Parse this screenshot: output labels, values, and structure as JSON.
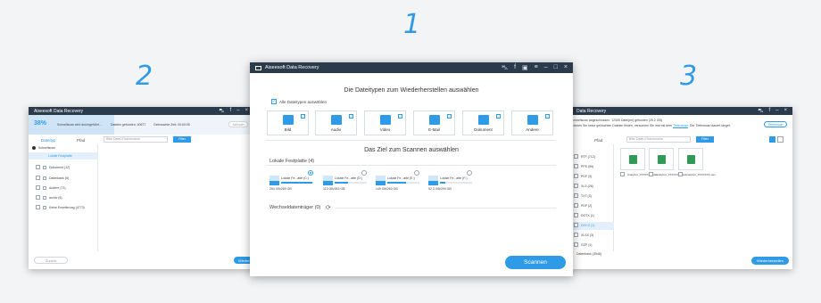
{
  "steps": [
    "1",
    "2",
    "3"
  ],
  "colors": {
    "accent": "#2f9be6",
    "titlebar": "#2b3b4b"
  },
  "left": {
    "app_title": "Aiseesoft Data Recovery",
    "progress": "38%",
    "progress_fraction": 0.38,
    "status": "Schnellscan wird durchgeführt...",
    "files_found": "Dateien gefunden: 40677",
    "elapsed": "Gebrauchte Zeit: 00:00:05",
    "pause_label": "Abbruch",
    "tabs": [
      "Dateityp",
      "Pfad"
    ],
    "search_placeholder": "Bitte Datei-/Ordnername",
    "filter_label": "Filter",
    "tree_root": "Schnellscan",
    "tree_folder": "Lokale Festplatte",
    "tree_items": [
      "Dokument (12)",
      "Datenbank (6)",
      "Andere (73)",
      "archiv (6)",
      "Keine Erweiterung (4773)"
    ],
    "back_label": "Zurück",
    "recover_label": "Wiederherstellen"
  },
  "center": {
    "app_title": "Aiseesoft Data Recovery",
    "heading_types": "Die Dateitypen zum Wiederherstellen auswählen",
    "all_types_label": "Alle Dateitypen auswählen",
    "types": [
      {
        "label": "Bild",
        "icon": "image-icon"
      },
      {
        "label": "Audio",
        "icon": "audio-icon"
      },
      {
        "label": "Video",
        "icon": "video-icon"
      },
      {
        "label": "E-Mail",
        "icon": "email-icon"
      },
      {
        "label": "Dokument",
        "icon": "document-icon"
      },
      {
        "label": "Andere",
        "icon": "other-icon"
      }
    ],
    "heading_target": "Das Ziel zum Scannen auswählen",
    "local_disk_label": "Lokale Festplatte (4)",
    "drives": [
      {
        "name": "Lokale Fe...atte (C:)",
        "size": "264 GB/269 GB"
      },
      {
        "name": "Lokale Fe...atte (D:)",
        "size": "113 GB/263 GB"
      },
      {
        "name": "Lokale Fe...atte (E:)",
        "size": "149 GB/263 GB"
      },
      {
        "name": "Lokale Fe...atte (F:)",
        "size": "52.3 GB/299 GB"
      }
    ],
    "removable_label": "Wechseldatenträger (0)",
    "scan_label": "Scannen"
  },
  "right": {
    "app_title": "Data Recovery",
    "status1": "Schnellscan abgeschlossen. 12305 Datei(en) gefunden (25.2 GB)",
    "status2": "Können Sie keine gelöschten Dateien finden, versuchen Sie mal mit dem",
    "deep_scan_link": "Tiefenscan",
    "status3": ". Der Tiefenscan dauert länger.",
    "deep_scan_button": "Tiefenscan",
    "tab": "Pfad",
    "search_placeholder": "Bitte Datei-/Ordnername",
    "filter_label": "Filter",
    "list_items": [
      "RTF (712)",
      "PPS (59)",
      "PDF (3)",
      "XLS (26)",
      "TXT (3)",
      "PDF (2)",
      "DOTX (1)",
      "DOCX (1)",
      "XLSX (3)",
      "GZP (1)",
      "Datenbank (3948)"
    ],
    "thumbs": [
      "Analytics_XXXXXXX.xlsx",
      "Analytics_XXXXXXX.xlsx",
      "Analytics_XXXXXXX.xlsx"
    ],
    "recover_label": "Wiederherstellen"
  }
}
